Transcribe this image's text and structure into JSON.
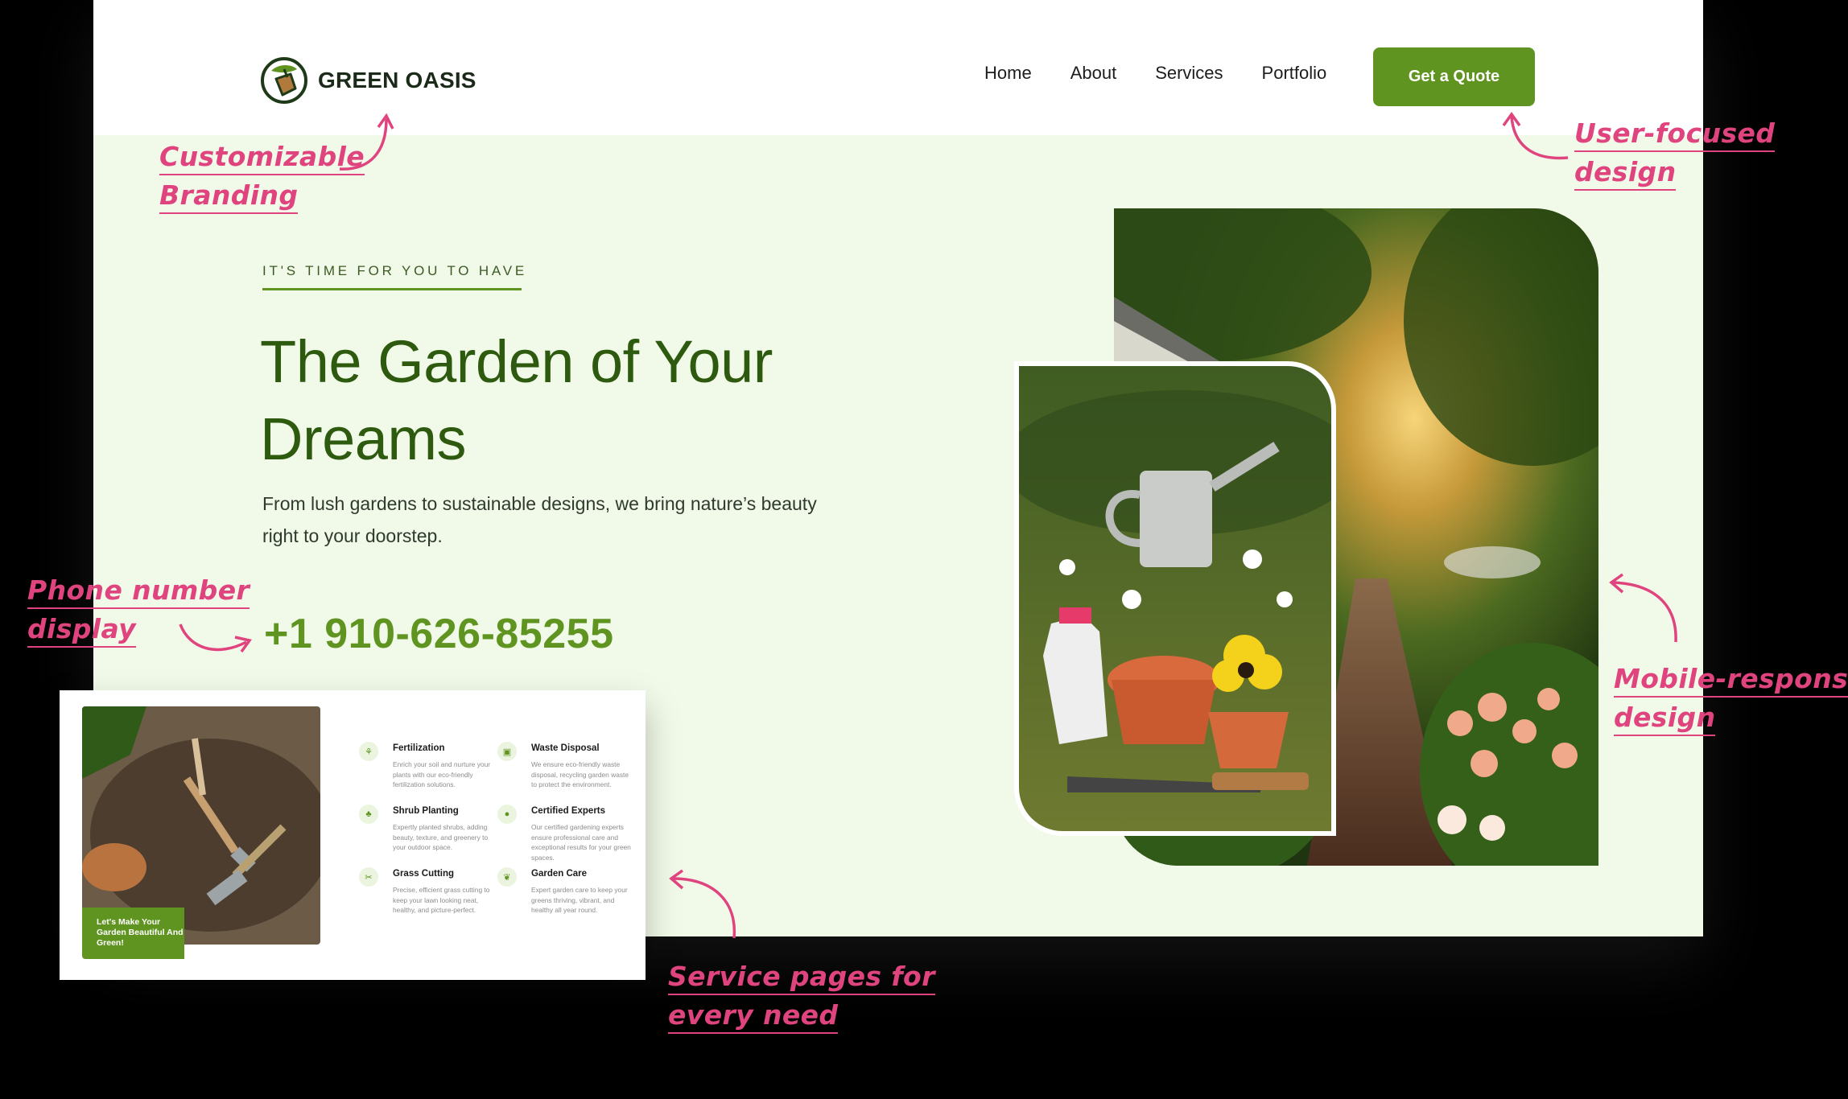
{
  "brand": {
    "name": "GREEN OASIS",
    "color_primary": "#5f9421",
    "color_title": "#2d5a0e",
    "icon": "leaf-shovel-logo-icon"
  },
  "nav": {
    "items": [
      "Home",
      "About",
      "Services",
      "Portfolio"
    ],
    "cta": "Get a Quote"
  },
  "hero": {
    "eyebrow": "IT'S TIME FOR YOU TO HAVE",
    "title": "The Garden of Your Dreams",
    "description": "From lush gardens to sustainable designs, we bring nature’s beauty right to your doorstep.",
    "phone": "+1 910-626-85255"
  },
  "services_card": {
    "badge": "Let's Make Your Garden Beautiful And Green!",
    "items": [
      {
        "name": "Fertilization",
        "text": "Enrich your soil and nurture your plants with our eco-friendly fertilization solutions.",
        "icon": "fertilizer-icon"
      },
      {
        "name": "Waste Disposal",
        "text": "We ensure eco-friendly waste disposal, recycling garden waste to protect the environment.",
        "icon": "trash-icon"
      },
      {
        "name": "Shrub Planting",
        "text": "Expertly planted shrubs, adding beauty, texture, and greenery to your outdoor space.",
        "icon": "sprout-icon"
      },
      {
        "name": "Certified Experts",
        "text": "Our certified gardening experts ensure professional care and exceptional results for your green spaces.",
        "icon": "badge-icon"
      },
      {
        "name": "Grass Cutting",
        "text": "Precise, efficient grass cutting to keep your lawn looking neat, healthy, and picture-perfect.",
        "icon": "scissors-icon"
      },
      {
        "name": "Garden Care",
        "text": "Expert garden care to keep your greens thriving, vibrant, and healthy all year round.",
        "icon": "leaf-icon"
      }
    ]
  },
  "annotations": {
    "branding": [
      "Customizable",
      "Branding"
    ],
    "user_focused": [
      "User-focused",
      "design"
    ],
    "phone": [
      "Phone number",
      "display"
    ],
    "mobile": [
      "Mobile-responsive",
      "design"
    ],
    "service_pages": [
      "Service pages for",
      "every need"
    ],
    "color": "#e0447f"
  }
}
